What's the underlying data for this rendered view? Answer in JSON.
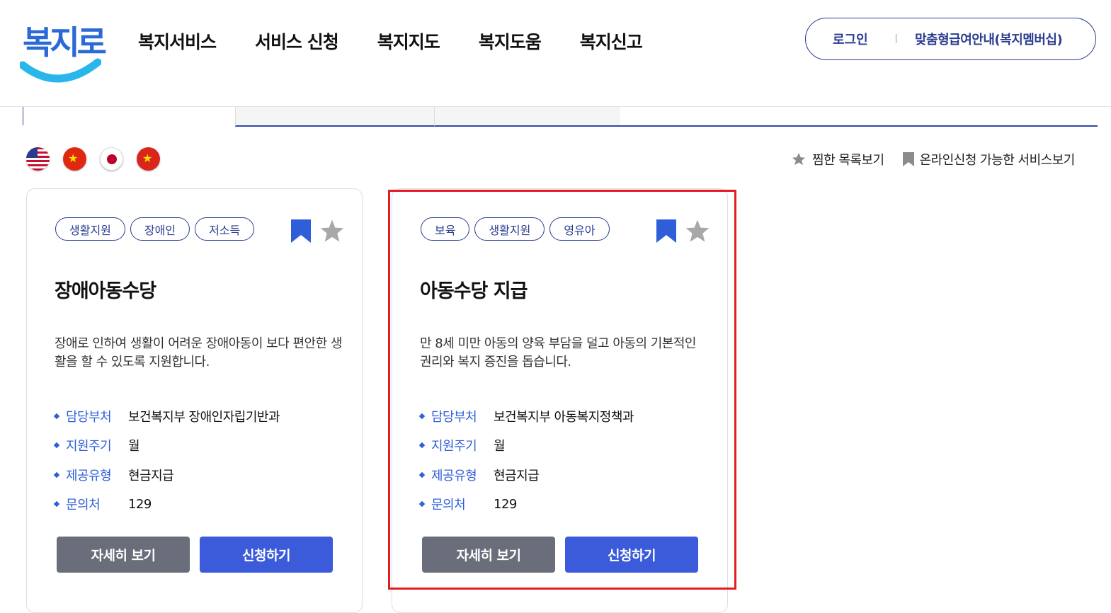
{
  "header": {
    "logo_text": "복지로",
    "nav": [
      "복지서비스",
      "서비스 신청",
      "복지지도",
      "복지도움",
      "복지신고"
    ],
    "login": "로그인",
    "member": "맞춤형급여안내(복지멤버십)"
  },
  "flags": [
    "us-flag-icon",
    "china-flag-icon",
    "japan-flag-icon",
    "vietnam-flag-icon"
  ],
  "filters": {
    "favorites": "찜한 목록보기",
    "online": "온라인신청 가능한 서비스보기"
  },
  "labels": {
    "dept": "담당부처",
    "cycle": "지원주기",
    "type": "제공유형",
    "contact": "문의처"
  },
  "cards": [
    {
      "tags": [
        "생활지원",
        "장애인",
        "저소득"
      ],
      "title": "장애아동수당",
      "desc": "장애로 인하여 생활이 어려운 장애아동이 보다 편안한 생활을 할 수 있도록 지원합니다.",
      "dept": "보건복지부 장애인자립기반과",
      "cycle": "월",
      "type": "현금지급",
      "contact": "129",
      "detail_btn": "자세히 보기",
      "apply_btn": "신청하기"
    },
    {
      "tags": [
        "보육",
        "생활지원",
        "영유아"
      ],
      "title": "아동수당 지급",
      "desc": "만 8세 미만 아동의 양육 부담을 덜고 아동의 기본적인 권리와 복지 증진을 돕습니다.",
      "dept": "보건복지부 아동복지정책과",
      "cycle": "월",
      "type": "현금지급",
      "contact": "129",
      "detail_btn": "자세히 보기",
      "apply_btn": "신청하기"
    }
  ],
  "colors": {
    "brand": "#2f5fd8",
    "navy": "#2b3d8f",
    "highlight": "#e41b23",
    "detail_btn": "#6a6e7a",
    "apply_btn": "#3b5bdb"
  }
}
